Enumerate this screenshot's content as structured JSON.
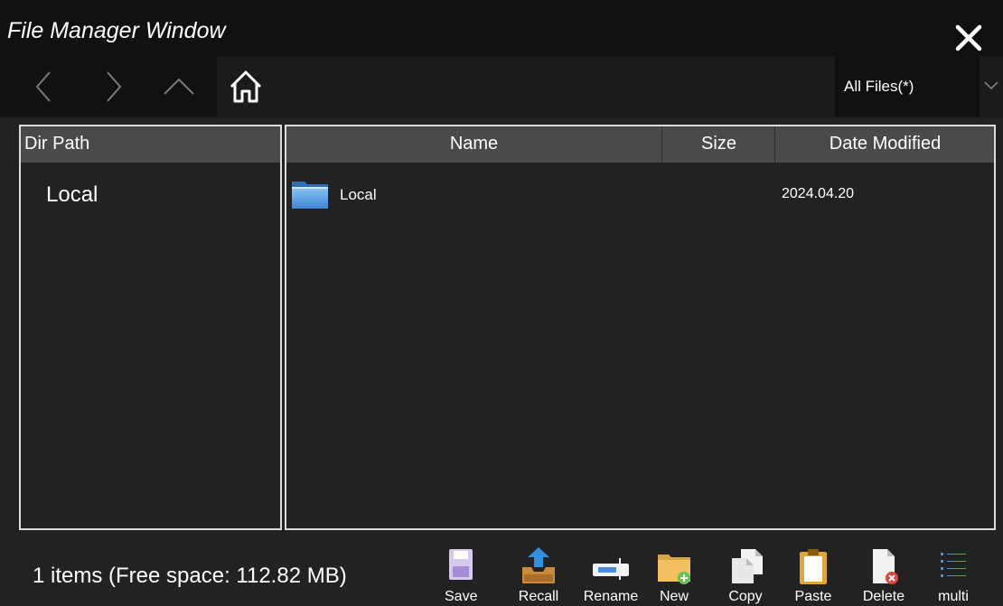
{
  "window": {
    "title": "File Manager Window"
  },
  "icons": {
    "close": "close-icon",
    "back": "chevron-left-icon",
    "forward": "chevron-right-icon",
    "up": "chevron-up-icon",
    "home": "home-icon",
    "folder": "folder-icon"
  },
  "filter": {
    "value": "All Files(*)"
  },
  "dir_panel": {
    "header": "Dir Path",
    "items": [
      "Local"
    ]
  },
  "file_table": {
    "columns": [
      "Name",
      "Size",
      "Date Modified"
    ],
    "rows": [
      {
        "name": "Local",
        "size": "",
        "date": "2024.04.20"
      }
    ]
  },
  "status": {
    "text": "1 items (Free space: 112.82 MB)"
  },
  "toolbar": {
    "items": [
      {
        "label": "Save",
        "icon": "save-icon"
      },
      {
        "label": "Recall",
        "icon": "recall-icon"
      },
      {
        "label": "Rename",
        "icon": "rename-icon"
      },
      {
        "label": "New",
        "icon": "new-folder-icon"
      },
      {
        "label": "Copy",
        "icon": "copy-icon"
      },
      {
        "label": "Paste",
        "icon": "paste-icon"
      },
      {
        "label": "Delete",
        "icon": "delete-icon"
      },
      {
        "label": "multi",
        "icon": "multi-select-icon"
      }
    ]
  },
  "colors": {
    "background": "#222222",
    "titlebar": "#111111",
    "header": "#4a4a4a",
    "border": "#dcdcdc",
    "folder": "#4a90d9"
  }
}
